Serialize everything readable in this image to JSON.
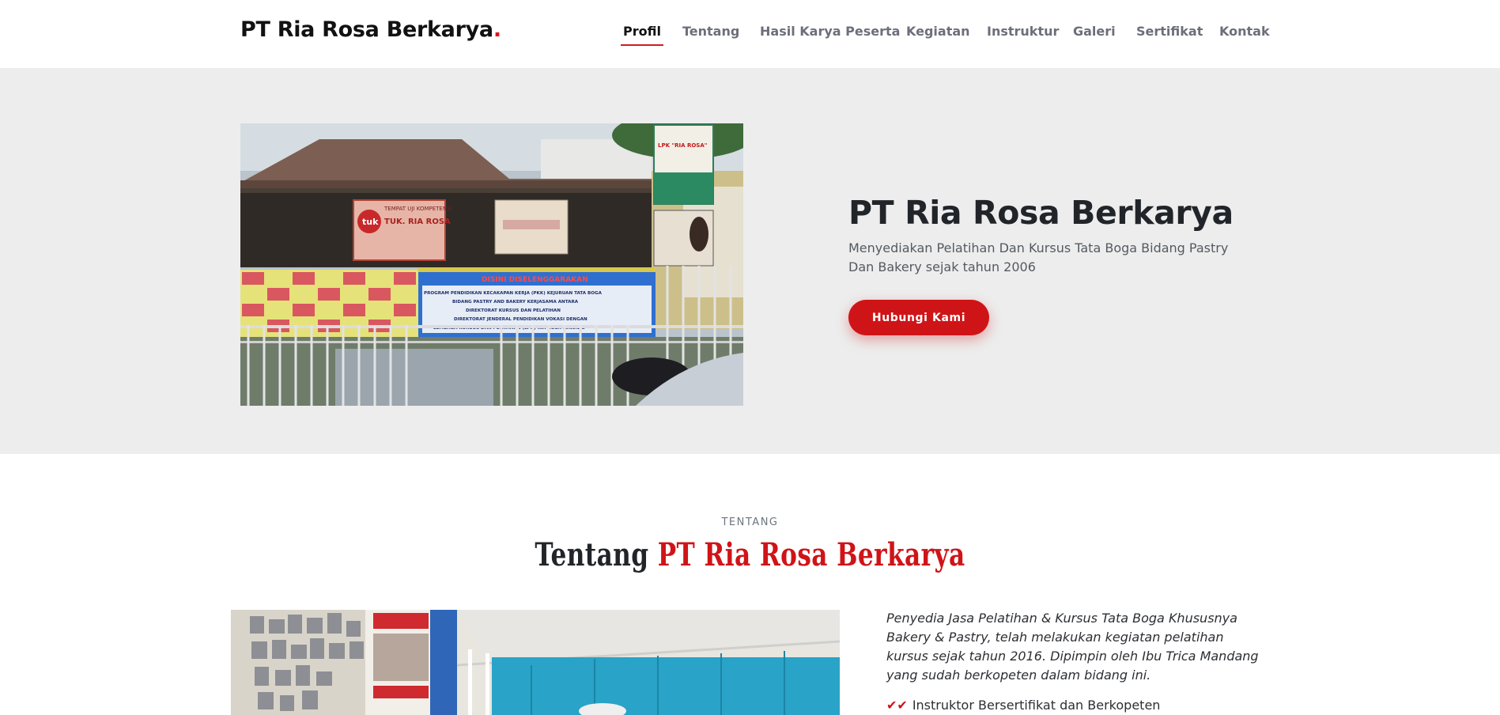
{
  "brand": {
    "name": "PT Ria Rosa Berkarya",
    "dot": ".",
    "accent_color": "#cf1418"
  },
  "nav": {
    "items": [
      {
        "label": "Profil",
        "active": true
      },
      {
        "label": "Tentang"
      },
      {
        "label": "Hasil Karya Peserta"
      },
      {
        "label": "Kegiatan"
      },
      {
        "label": "Instruktur"
      },
      {
        "label": "Galeri"
      },
      {
        "label": "Sertifikat"
      },
      {
        "label": "Kontak"
      }
    ]
  },
  "hero": {
    "title": "PT Ria Rosa Berkarya",
    "subtitle": "Menyediakan Pelatihan Dan Kursus Tata Boga Bidang Pastry Dan Bakery sejak tahun 2006",
    "cta_label": "Hubungi Kami",
    "photo": {
      "sign_left_line1": "TEMPAT UJI KOMPETENSI",
      "sign_left_line2": "TUK. RIA ROSA",
      "sign_left_logo": "tuk",
      "banner_title": "DISINI DISELENGGARAKAN",
      "banner_line1": "PROGRAM PENDIDIKAN KECAKAPAN KERJA (PKK) KEJURUAN TATA BOGA",
      "banner_line2": "BIDANG PASTRY AND BAKERY KERJASAMA ANTARA",
      "banner_line3": "DIREKTORAT KURSUS DAN PELATIHAN",
      "banner_line4": "DIREKTORAT JENDERAL PENDIDIKAN VOKASI DENGAN",
      "banner_line5": "LEMBAGA KURSUS DAN PELATIHAN (LPK) RIA ROSA MANADO",
      "poster_text": "LPK \"RIA ROSA\""
    }
  },
  "about": {
    "kicker": "TENTANG",
    "title_plain": "Tentang ",
    "title_accent": "PT Ria Rosa Berkarya",
    "description": "Penyedia Jasa Pelatihan & Kursus Tata Boga Khususnya Bakery & Pastry, telah melakukan kegiatan pelatihan kursus sejak tahun 2016. Dipimpin oleh Ibu Trica Mandang yang sudah berkopeten dalam bidang ini.",
    "list": [
      {
        "icon": "double-check-icon",
        "text": "Instruktor Bersertifikat dan Berkopeten"
      }
    ]
  }
}
